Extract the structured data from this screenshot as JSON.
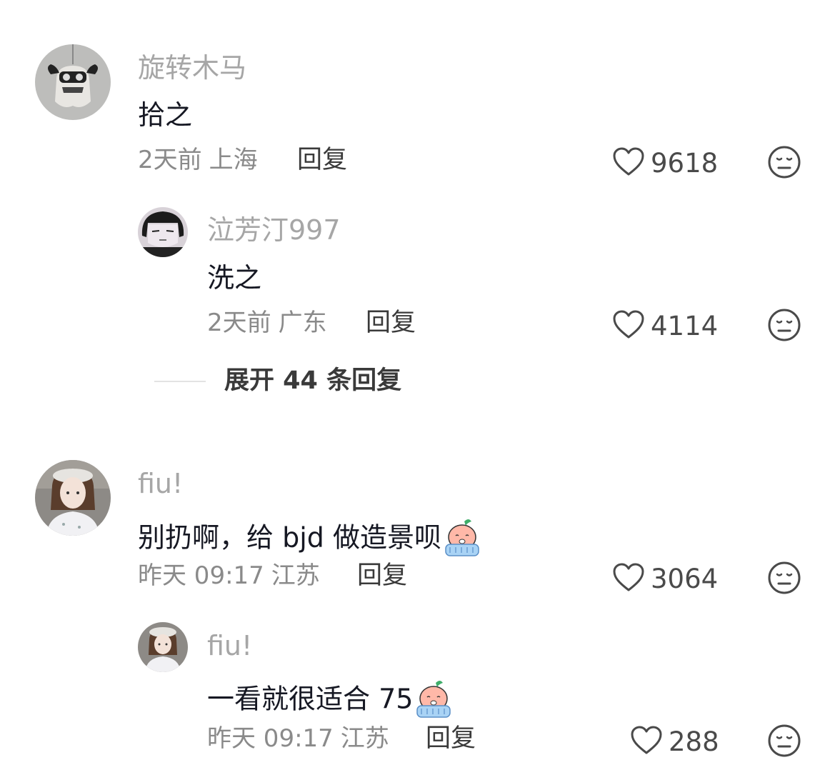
{
  "comments": [
    {
      "username": "旋转木马",
      "content": "拾之",
      "date": "2天前",
      "location": "上海",
      "reply_label": "回复",
      "likes": "9618",
      "replies": [
        {
          "username": "泣芳汀997",
          "content": "洗之",
          "date": "2天前",
          "location": "广东",
          "reply_label": "回复",
          "likes": "4114"
        }
      ],
      "expand_label": "展开 44 条回复"
    },
    {
      "username": "fiu!",
      "content": "别扔啊，给 bjd 做造景呗",
      "date": "昨天 09:17",
      "location": "江苏",
      "reply_label": "回复",
      "likes": "3064",
      "replies": [
        {
          "username": "fiu!",
          "content": "一看就很适合 75",
          "date": "昨天 09:17",
          "location": "江苏",
          "reply_label": "回复",
          "likes": "288"
        }
      ]
    }
  ],
  "icons": {
    "like": "heart-outline-icon",
    "dislike": "unamused-face-icon",
    "inline_emoji": "crying-emoji"
  },
  "colors": {
    "username": "#a6a6a6",
    "content": "#161823",
    "meta": "#8a8a8a",
    "icon_stroke": "#4a4a4a"
  }
}
